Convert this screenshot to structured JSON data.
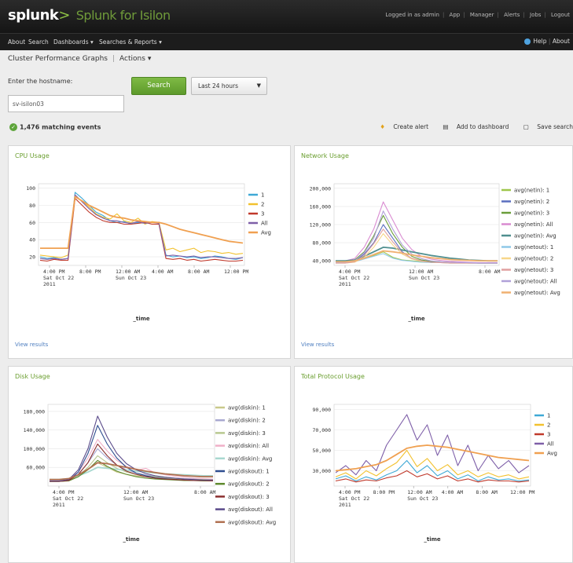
{
  "header": {
    "brand": "splunk",
    "brand_sep": ">",
    "app_name": "Splunk for Isilon",
    "top_links": [
      "Logged in as admin",
      "App",
      "Manager",
      "Alerts",
      "Jobs",
      "Logout"
    ]
  },
  "nav": {
    "items": [
      "About",
      "Search",
      "Dashboards",
      "Searches & Reports"
    ],
    "help": "Help",
    "about": "About"
  },
  "page": {
    "title": "Cluster Performance Graphs",
    "actions_label": "Actions"
  },
  "form": {
    "host_label": "Enter the hostname:",
    "host_value": "sv-isilon03",
    "search_label": "Search",
    "time_range": "Last 24 hours"
  },
  "results": {
    "events": "1,476 matching events",
    "create_alert": "Create alert",
    "add_dashboard": "Add to dashboard",
    "save_search": "Save search"
  },
  "colors": {
    "accent_green": "#6a9e2f",
    "navbar": "#1c1c1c"
  },
  "chart_data": [
    {
      "type": "line",
      "title": "CPU Usage",
      "xlabel": "_time",
      "x_ticks": [
        [
          "4:00 PM",
          "Sat Oct 22",
          "2011"
        ],
        [
          "8:00 PM"
        ],
        [
          "12:00 AM",
          "Sun Oct 23"
        ],
        [
          "4:00 AM"
        ],
        [
          "8:00 AM"
        ],
        [
          "12:00 PM"
        ]
      ],
      "y_ticks": [
        100,
        80,
        60,
        40,
        20
      ],
      "ylim": [
        10,
        105
      ],
      "legend": "right",
      "view_results": "View results",
      "series": [
        {
          "name": "1",
          "color": "#3fa9d6",
          "values": [
            20,
            18,
            19,
            17,
            18,
            95,
            88,
            80,
            72,
            68,
            62,
            60,
            61,
            58,
            60,
            59,
            60,
            60,
            22,
            20,
            21,
            19,
            20,
            18,
            19,
            21,
            20,
            18,
            17,
            19
          ]
        },
        {
          "name": "2",
          "color": "#f2c12e",
          "values": [
            22,
            21,
            20,
            19,
            22,
            90,
            85,
            78,
            70,
            66,
            64,
            70,
            62,
            60,
            65,
            58,
            61,
            60,
            28,
            30,
            26,
            28,
            30,
            25,
            27,
            26,
            24,
            25,
            23,
            24
          ]
        },
        {
          "name": "3",
          "color": "#c0392b",
          "values": [
            16,
            15,
            17,
            16,
            16,
            88,
            80,
            72,
            66,
            62,
            60,
            60,
            58,
            58,
            59,
            60,
            58,
            58,
            18,
            17,
            18,
            16,
            17,
            15,
            16,
            17,
            16,
            15,
            15,
            16
          ]
        },
        {
          "name": "All",
          "color": "#7e5fa8",
          "values": [
            18,
            17,
            18,
            17,
            18,
            92,
            84,
            76,
            69,
            65,
            62,
            62,
            60,
            59,
            61,
            59,
            60,
            59,
            21,
            22,
            21,
            20,
            21,
            19,
            20,
            20,
            19,
            18,
            18,
            19
          ]
        },
        {
          "name": "Avg",
          "color": "#f0a050",
          "values": [
            30,
            30,
            30,
            30,
            30,
            90,
            85,
            80,
            76,
            72,
            68,
            66,
            65,
            63,
            62,
            61,
            60,
            60,
            58,
            55,
            52,
            50,
            48,
            46,
            44,
            42,
            40,
            38,
            37,
            36
          ]
        }
      ]
    },
    {
      "type": "line",
      "title": "Network Usage",
      "xlabel": "_time",
      "x_ticks": [
        [
          "4:00 PM",
          "Sat Oct 22",
          "2011"
        ],
        [
          "12:00 AM",
          "Sun Oct 23"
        ],
        [
          "8:00 AM"
        ]
      ],
      "y_ticks": [
        "200,000",
        "160,000",
        "120,000",
        "80,000",
        "40,000"
      ],
      "ylim": [
        30000,
        210000
      ],
      "legend": "right",
      "view_results": "View results",
      "series": [
        {
          "name": "avg(netin): 1",
          "color": "#9ec64b",
          "values": [
            38000,
            38000,
            40000,
            45000,
            52000,
            60000,
            48000,
            42000,
            40000,
            38000,
            37000,
            37000,
            36000,
            36000,
            36000,
            35000,
            35000,
            35000
          ]
        },
        {
          "name": "avg(netin): 2",
          "color": "#5b6fbf",
          "values": [
            36000,
            36000,
            39000,
            55000,
            80000,
            120000,
            90000,
            60000,
            45000,
            40000,
            38000,
            37000,
            36000,
            36000,
            35000,
            35000,
            35000,
            35000
          ]
        },
        {
          "name": "avg(netin): 3",
          "color": "#6a9e3a",
          "values": [
            37000,
            37000,
            42000,
            60000,
            95000,
            140000,
            100000,
            70000,
            50000,
            42000,
            39000,
            38000,
            37000,
            36000,
            36000,
            35000,
            35000,
            35000
          ]
        },
        {
          "name": "avg(netin): All",
          "color": "#d98bd1",
          "values": [
            38000,
            40000,
            45000,
            70000,
            110000,
            170000,
            130000,
            90000,
            65000,
            50000,
            44000,
            41000,
            39000,
            38000,
            37000,
            36000,
            36000,
            36000
          ]
        },
        {
          "name": "avg(netin): Avg",
          "color": "#4f8f8f",
          "values": [
            40000,
            40000,
            42000,
            50000,
            60000,
            70000,
            68000,
            64000,
            60000,
            56000,
            52000,
            49000,
            46000,
            44000,
            42000,
            41000,
            40000,
            40000
          ]
        },
        {
          "name": "avg(netout): 1",
          "color": "#8fc8e8",
          "values": [
            36000,
            36000,
            38000,
            44000,
            50000,
            56000,
            46000,
            41000,
            39000,
            37000,
            36000,
            36000,
            35000,
            35000,
            35000,
            35000,
            35000,
            35000
          ]
        },
        {
          "name": "avg(netout): 2",
          "color": "#f7d68a",
          "values": [
            35000,
            35000,
            37000,
            48000,
            70000,
            100000,
            75000,
            55000,
            44000,
            39000,
            37000,
            36000,
            35000,
            35000,
            35000,
            35000,
            35000,
            35000
          ]
        },
        {
          "name": "avg(netout): 3",
          "color": "#e0a0a0",
          "values": [
            35000,
            35000,
            38000,
            52000,
            78000,
            110000,
            82000,
            58000,
            46000,
            40000,
            37000,
            36000,
            35000,
            35000,
            35000,
            35000,
            35000,
            35000
          ]
        },
        {
          "name": "avg(netout): All",
          "color": "#b0a0d8",
          "values": [
            36000,
            37000,
            40000,
            58000,
            90000,
            150000,
            110000,
            75000,
            55000,
            45000,
            40000,
            38000,
            37000,
            36000,
            36000,
            35000,
            35000,
            35000
          ]
        },
        {
          "name": "avg(netout): Avg",
          "color": "#f0b070",
          "values": [
            38000,
            38000,
            40000,
            46000,
            54000,
            62000,
            60000,
            57000,
            53000,
            50000,
            47000,
            45000,
            43000,
            42000,
            41000,
            40000,
            40000,
            40000
          ]
        }
      ]
    },
    {
      "type": "line",
      "title": "Disk Usage",
      "xlabel": "_time",
      "x_ticks": [
        [
          "4:00 PM",
          "Sat Oct 22",
          "2011"
        ],
        [
          "12:00 AM",
          "Sun Oct 23"
        ],
        [
          "8:00 AM"
        ]
      ],
      "y_ticks": [
        "180,000",
        "140,000",
        "100,000",
        "60,000"
      ],
      "ylim": [
        20000,
        195000
      ],
      "legend": "right",
      "view_results": "View results",
      "series": [
        {
          "name": "avg(diskin): 1",
          "color": "#c9c98a",
          "values": [
            30000,
            30000,
            32000,
            40000,
            55000,
            70000,
            60000,
            50000,
            45000,
            42000,
            40000,
            38000,
            36000,
            35000,
            34000,
            33000,
            33000,
            32000
          ]
        },
        {
          "name": "avg(diskin): 2",
          "color": "#a8a8d0",
          "values": [
            32000,
            32000,
            34000,
            45000,
            70000,
            100000,
            80000,
            65000,
            55000,
            48000,
            44000,
            41000,
            39000,
            37000,
            36000,
            35000,
            34000,
            34000
          ]
        },
        {
          "name": "avg(diskin): 3",
          "color": "#b8c890",
          "values": [
            31000,
            31000,
            33000,
            42000,
            60000,
            85000,
            70000,
            58000,
            50000,
            45000,
            42000,
            40000,
            38000,
            36000,
            35000,
            34000,
            34000,
            33000
          ]
        },
        {
          "name": "avg(diskin): All",
          "color": "#f0b0c8",
          "values": [
            33000,
            33000,
            36000,
            50000,
            80000,
            120000,
            95000,
            75000,
            62000,
            54000,
            58000,
            48000,
            44000,
            41000,
            39000,
            37000,
            36000,
            35000
          ]
        },
        {
          "name": "avg(diskin): Avg",
          "color": "#a8d8d0",
          "values": [
            34000,
            34000,
            36000,
            42000,
            50000,
            60000,
            58000,
            56000,
            54000,
            52000,
            50000,
            48000,
            46000,
            45000,
            44000,
            43000,
            42000,
            42000
          ]
        },
        {
          "name": "avg(diskout): 1",
          "color": "#2e4d8f",
          "values": [
            30000,
            30000,
            32000,
            50000,
            90000,
            150000,
            110000,
            80000,
            60000,
            48000,
            42000,
            38000,
            36000,
            34000,
            33000,
            32000,
            32000,
            31000
          ]
        },
        {
          "name": "avg(diskout): 2",
          "color": "#5f8a2e",
          "values": [
            30000,
            30000,
            31000,
            40000,
            55000,
            75000,
            62000,
            52000,
            45000,
            40000,
            37000,
            35000,
            34000,
            33000,
            32000,
            32000,
            31000,
            31000
          ]
        },
        {
          "name": "avg(diskout): 3",
          "color": "#8a2e2e",
          "values": [
            30000,
            30000,
            32000,
            45000,
            70000,
            110000,
            85000,
            65000,
            52000,
            45000,
            40000,
            37000,
            35000,
            34000,
            33000,
            32000,
            32000,
            31000
          ]
        },
        {
          "name": "avg(diskout): All",
          "color": "#5a4a8a",
          "values": [
            31000,
            31000,
            34000,
            55000,
            100000,
            170000,
            125000,
            90000,
            68000,
            55000,
            47000,
            42000,
            39000,
            37000,
            35000,
            34000,
            33000,
            33000
          ]
        },
        {
          "name": "avg(diskout): Avg",
          "color": "#b07050",
          "values": [
            34000,
            34000,
            36000,
            44000,
            56000,
            70000,
            68000,
            64000,
            60000,
            56000,
            52000,
            49000,
            46000,
            44000,
            42000,
            41000,
            40000,
            40000
          ]
        }
      ]
    },
    {
      "type": "line",
      "title": "Total Protocol Usage",
      "xlabel": "_time",
      "x_ticks": [
        [
          "4:00 PM",
          "Sat Oct 22",
          "2011"
        ],
        [
          "8:00 PM"
        ],
        [
          "12:00 AM",
          "Sun Oct 23"
        ],
        [
          "4:00 AM"
        ],
        [
          "8:00 AM"
        ],
        [
          "12:00 PM"
        ]
      ],
      "y_ticks": [
        "90,000",
        "70,000",
        "50,000",
        "30,000"
      ],
      "ylim": [
        15000,
        95000
      ],
      "legend": "right",
      "view_results": "View results",
      "series": [
        {
          "name": "1",
          "color": "#3fa9d6",
          "values": [
            22000,
            25000,
            20000,
            24000,
            21000,
            26000,
            30000,
            40000,
            28000,
            35000,
            25000,
            30000,
            22000,
            26000,
            20000,
            24000,
            21000,
            22000,
            20000,
            21000
          ]
        },
        {
          "name": "2",
          "color": "#f2c12e",
          "values": [
            24000,
            28000,
            22000,
            30000,
            25000,
            32000,
            38000,
            50000,
            34000,
            42000,
            30000,
            36000,
            26000,
            30000,
            24000,
            28000,
            24000,
            26000,
            22000,
            24000
          ]
        },
        {
          "name": "3",
          "color": "#c0392b",
          "values": [
            20000,
            22000,
            19000,
            21000,
            20000,
            23000,
            25000,
            30000,
            24000,
            27000,
            22000,
            25000,
            20000,
            22000,
            19000,
            21000,
            20000,
            20000,
            19000,
            20000
          ]
        },
        {
          "name": "All",
          "color": "#7e5fa8",
          "values": [
            28000,
            35000,
            26000,
            40000,
            30000,
            55000,
            70000,
            85000,
            60000,
            75000,
            45000,
            65000,
            35000,
            55000,
            30000,
            45000,
            32000,
            40000,
            28000,
            35000
          ]
        },
        {
          "name": "Avg",
          "color": "#f0a050",
          "values": [
            30000,
            31000,
            32000,
            34000,
            36000,
            40000,
            46000,
            52000,
            54000,
            55000,
            54000,
            53000,
            51000,
            49000,
            47000,
            45000,
            43000,
            42000,
            41000,
            40000
          ]
        }
      ]
    }
  ]
}
